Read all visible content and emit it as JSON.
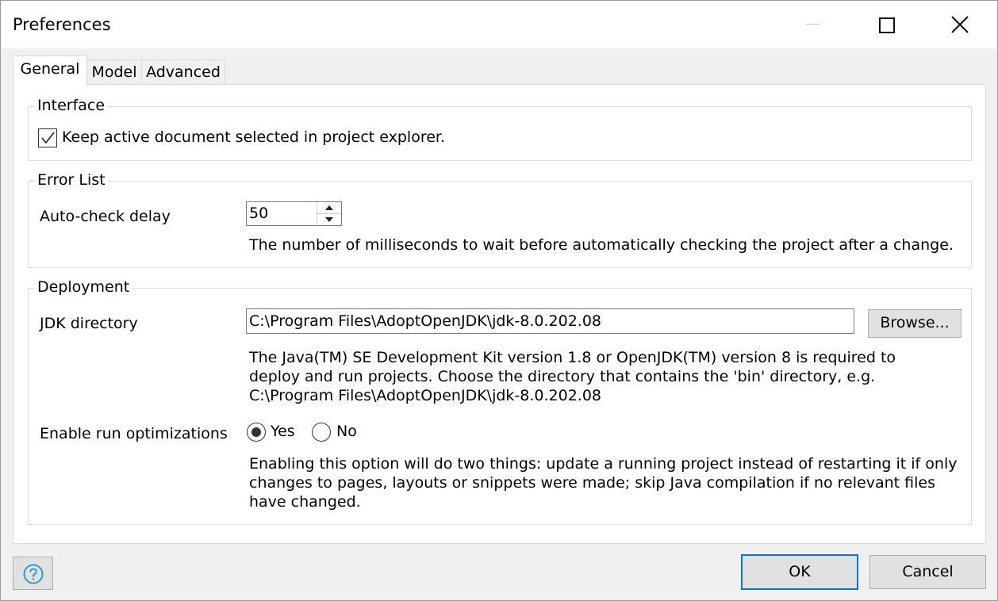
{
  "window": {
    "title": "Preferences"
  },
  "tabs": [
    {
      "label": "General",
      "active": true
    },
    {
      "label": "Model",
      "active": false
    },
    {
      "label": "Advanced",
      "active": false
    }
  ],
  "interface": {
    "legend": "Interface",
    "keep_active_label": "Keep active document selected in project explorer.",
    "keep_active_checked": true
  },
  "error_list": {
    "legend": "Error List",
    "delay_label": "Auto-check delay",
    "delay_value": "50",
    "delay_description": "The number of milliseconds to wait before automatically checking the project after a change."
  },
  "deployment": {
    "legend": "Deployment",
    "jdk_label": "JDK directory",
    "jdk_value": "C:\\Program Files\\AdoptOpenJDK\\jdk-8.0.202.08",
    "browse_label": "Browse...",
    "jdk_desc_line1": "The Java(TM) SE Development Kit version 1.8 or OpenJDK(TM) version 8 is required to",
    "jdk_desc_line2": "deploy and run projects. Choose the directory that contains the 'bin' directory, e.g.",
    "jdk_desc_line3": "C:\\Program Files\\AdoptOpenJDK\\jdk-8.0.202.08",
    "run_opt_label": "Enable run optimizations",
    "run_opt_yes": "Yes",
    "run_opt_no": "No",
    "run_opt_selected": "Yes",
    "run_opt_desc_line1": "Enabling this option will do two things: update a running project instead of restarting it if only",
    "run_opt_desc_line2": "changes to pages, layouts or snippets were made; skip Java compilation if no relevant files",
    "run_opt_desc_line3": "have changed."
  },
  "footer": {
    "ok_label": "OK",
    "cancel_label": "Cancel"
  },
  "icons": {
    "help": "help-icon",
    "minimize": "minimize-icon",
    "maximize": "maximize-icon",
    "close": "close-icon"
  },
  "colors": {
    "accent": "#0078d7",
    "help_icon": "#1e90e0"
  }
}
